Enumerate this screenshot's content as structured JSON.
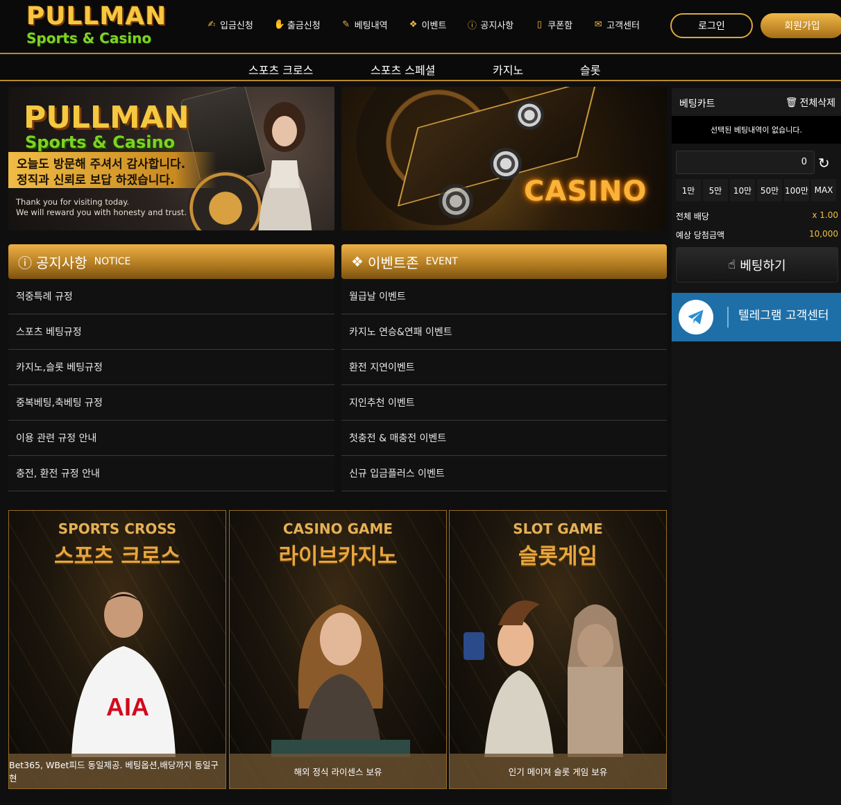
{
  "logo": {
    "line1": "PULLMAN",
    "line2": "Sports & Casino"
  },
  "nav": [
    {
      "label": "입금신청",
      "icon": "deposit-icon",
      "glyph": "✍"
    },
    {
      "label": "출금신청",
      "icon": "withdraw-icon",
      "glyph": "✋"
    },
    {
      "label": "베팅내역",
      "icon": "betting-history-icon",
      "glyph": "✎"
    },
    {
      "label": "이벤트",
      "icon": "gift-icon",
      "glyph": "🎁"
    },
    {
      "label": "공지사항",
      "icon": "notice-icon",
      "glyph": "ⓘ"
    },
    {
      "label": "쿠폰함",
      "icon": "coupon-icon",
      "glyph": "▯"
    },
    {
      "label": "고객센터",
      "icon": "chat-icon",
      "glyph": "💬"
    }
  ],
  "auth": {
    "login": "로그인",
    "join": "회원가입"
  },
  "subnav": [
    "스포츠 크로스",
    "스포츠 스페셜",
    "카지노",
    "슬롯"
  ],
  "banner1": {
    "logo1": "PULLMAN",
    "logo2": "Sports & Casino",
    "ko1": "오늘도 방문해 주셔서 감사합니다.",
    "ko2": "정직과 신뢰로 보답 하겠습니다.",
    "en1": "Thank you for visiting today.",
    "en2": "We will reward you with honesty and trust."
  },
  "banner2": {
    "text": "CASINO"
  },
  "notice": {
    "title": "공지사항",
    "title_en": "NOTICE",
    "icon": "notice-icon",
    "items": [
      "적중특례 규정",
      "스포츠 베팅규정",
      "카지노,슬롯 베팅규정",
      "중복베팅,축베팅 규정",
      "이용 관련 규정 안내",
      "충전, 환전 규정 안내"
    ]
  },
  "event": {
    "title": "이벤트존",
    "title_en": "EVENT",
    "icon": "gift-icon",
    "items": [
      "월급날 이벤트",
      "카지노 연승&연패 이벤트",
      "환전 지연이벤트",
      "지인추천 이벤트",
      "첫충전 & 매충전 이벤트",
      "신규 입금플러스 이벤트"
    ]
  },
  "games": [
    {
      "en": "SPORTS CROSS",
      "ko": "스포츠 크로스",
      "desc": "Bet365, WBet피드 동일제공. 베팅옵션,배당까지 동일구현"
    },
    {
      "en": "CASINO GAME",
      "ko": "라이브카지노",
      "desc": "해외 정식 라이센스 보유"
    },
    {
      "en": "SLOT GAME",
      "ko": "슬롯게임",
      "desc": "인기 메이져 슬롯 게임 보유"
    }
  ],
  "betslip": {
    "title": "베팅카트",
    "clear": "전체삭제",
    "empty": "선택된 베팅내역이 없습니다.",
    "amount": "0",
    "chips": [
      "1만",
      "5만",
      "10만",
      "50만",
      "100만",
      "MAX"
    ],
    "total_odds_label": "전체 배당",
    "total_odds_value": "x 1.00",
    "expected_label": "예상 당첨금액",
    "expected_value": "10,000",
    "bet_button": "베팅하기"
  },
  "telegram": {
    "label": "텔레그램 고객센터"
  },
  "colors": {
    "accent": "#e0a838",
    "telegram": "#1e6fa8",
    "odds": "#f0c040"
  }
}
